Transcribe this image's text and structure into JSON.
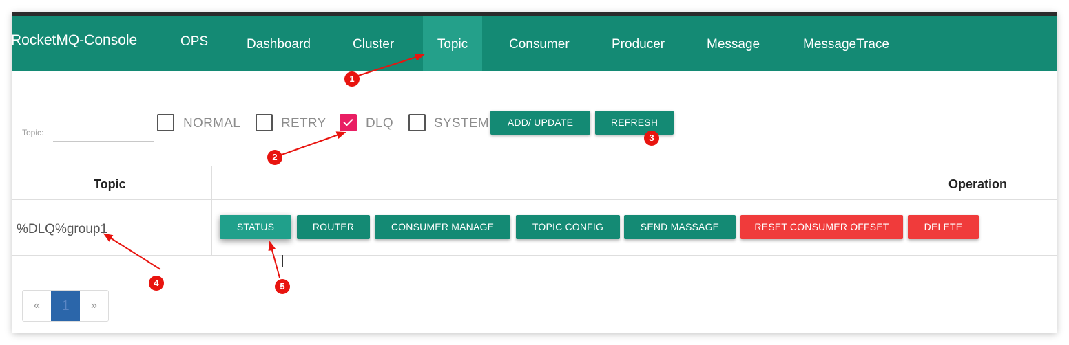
{
  "navbar": {
    "brand": "RocketMQ-Console",
    "items": [
      {
        "label": "OPS"
      },
      {
        "label": "Dashboard"
      },
      {
        "label": "Cluster"
      },
      {
        "label": "Topic"
      },
      {
        "label": "Consumer"
      },
      {
        "label": "Producer"
      },
      {
        "label": "Message"
      },
      {
        "label": "MessageTrace"
      }
    ],
    "active": "Topic"
  },
  "filter": {
    "topic_label": "Topic:",
    "topic_value": "",
    "checkboxes": [
      {
        "label": "NORMAL",
        "checked": false
      },
      {
        "label": "RETRY",
        "checked": false
      },
      {
        "label": "DLQ",
        "checked": true
      },
      {
        "label": "SYSTEM",
        "checked": false
      }
    ],
    "add_update_label": "ADD/ UPDATE",
    "refresh_label": "REFRESH"
  },
  "table": {
    "headers": {
      "topic": "Topic",
      "operation": "Operation"
    },
    "rows": [
      {
        "topic": "%DLQ%group1",
        "actions": [
          "STATUS",
          "ROUTER",
          "CONSUMER MANAGE",
          "TOPIC CONFIG",
          "SEND MASSAGE",
          "RESET CONSUMER OFFSET",
          "DELETE"
        ]
      }
    ]
  },
  "pagination": {
    "prev": "«",
    "current": "1",
    "next": "»"
  },
  "annotations": [
    "1",
    "2",
    "3",
    "4",
    "5"
  ],
  "colors": {
    "primary": "#148a74",
    "nav_active": "#24a08a",
    "danger": "#f03b3b",
    "checkbox_checked": "#e91e63",
    "page_current": "#2b66aa",
    "annotation": "#e8140f"
  }
}
